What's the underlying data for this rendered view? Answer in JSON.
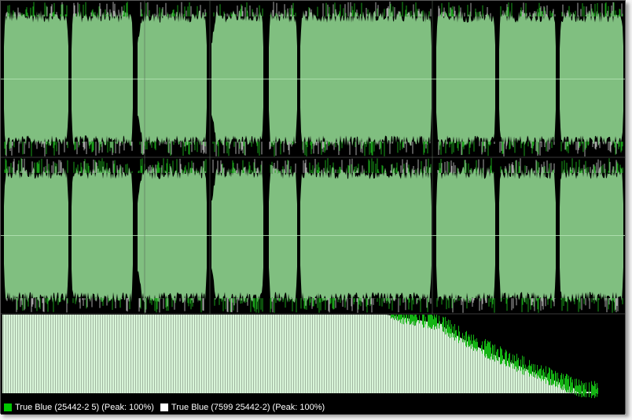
{
  "legend": {
    "items": [
      {
        "label": "True Blue (25442-2 5) (Peak: 100%)",
        "color": "#00c800"
      },
      {
        "label": "True Blue (7599 25442-2) (Peak: 100%)",
        "color": "#ffffff"
      }
    ]
  },
  "colors": {
    "background": "#000000",
    "waveform_fill": "#80bf80",
    "waveform_peak_a": "#1aa01a",
    "waveform_peak_b": "#a8a8a8",
    "spectrum_fill": "#d8f5d8",
    "spectrum_peak": "#14b414",
    "centerline": "#b8e6b8"
  }
}
